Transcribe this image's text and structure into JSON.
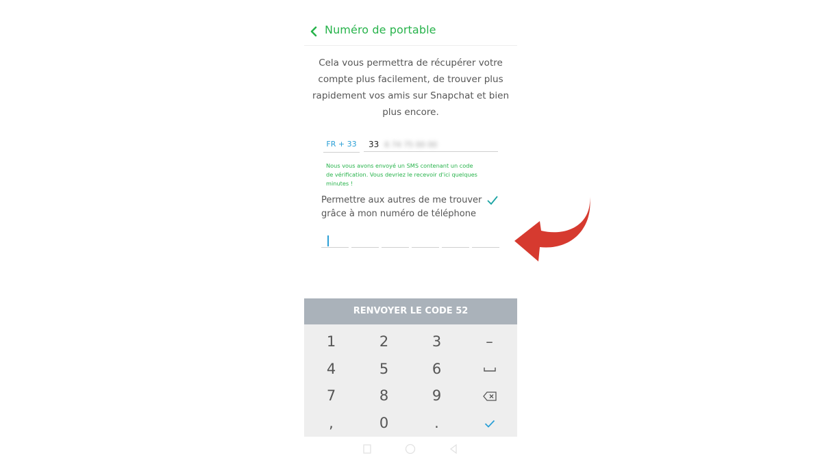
{
  "header": {
    "back_icon": "chevron-left-icon",
    "title": "Numéro de portable"
  },
  "description": {
    "lines": [
      "Cela vous permettra de récupérer votre",
      "compte plus facilement, de trouver plus",
      "rapidement vos amis sur Snapchat et bien",
      "plus encore."
    ]
  },
  "phone": {
    "country_code": "FR + 33",
    "number_visible": "33",
    "number_hidden": "6 74 75 00 00"
  },
  "sms_note": {
    "lines": [
      "Nous vous avons envoyé un SMS contenant un code",
      "de vérification. Vous devriez le recevoir d'ici quelques",
      "minutes !"
    ]
  },
  "permission": {
    "lines": [
      "Permettre aux autres de me trouver",
      "grâce à mon numéro de téléphone"
    ],
    "checked": true,
    "check_color": "#1aa3a3"
  },
  "verification_code": {
    "slots": [
      "",
      "",
      "",
      "",
      "",
      ""
    ]
  },
  "resend_button": {
    "label": "RENVOYER LE CODE 52"
  },
  "keypad": {
    "keys": [
      "1",
      "2",
      "3",
      "–",
      "4",
      "5",
      "6",
      "space-icon",
      "7",
      "8",
      "9",
      "backspace-icon",
      ",",
      "0",
      ".",
      "check-icon"
    ]
  },
  "navbar": {
    "icons": [
      "recent-apps-icon",
      "home-icon",
      "back-icon"
    ]
  },
  "colors": {
    "brand_green": "#27b34b",
    "link_blue": "#2a9fd6",
    "resend_bg": "#aab2ba",
    "keypad_bg": "#eeeeee",
    "arrow_red": "#d63a2f"
  }
}
